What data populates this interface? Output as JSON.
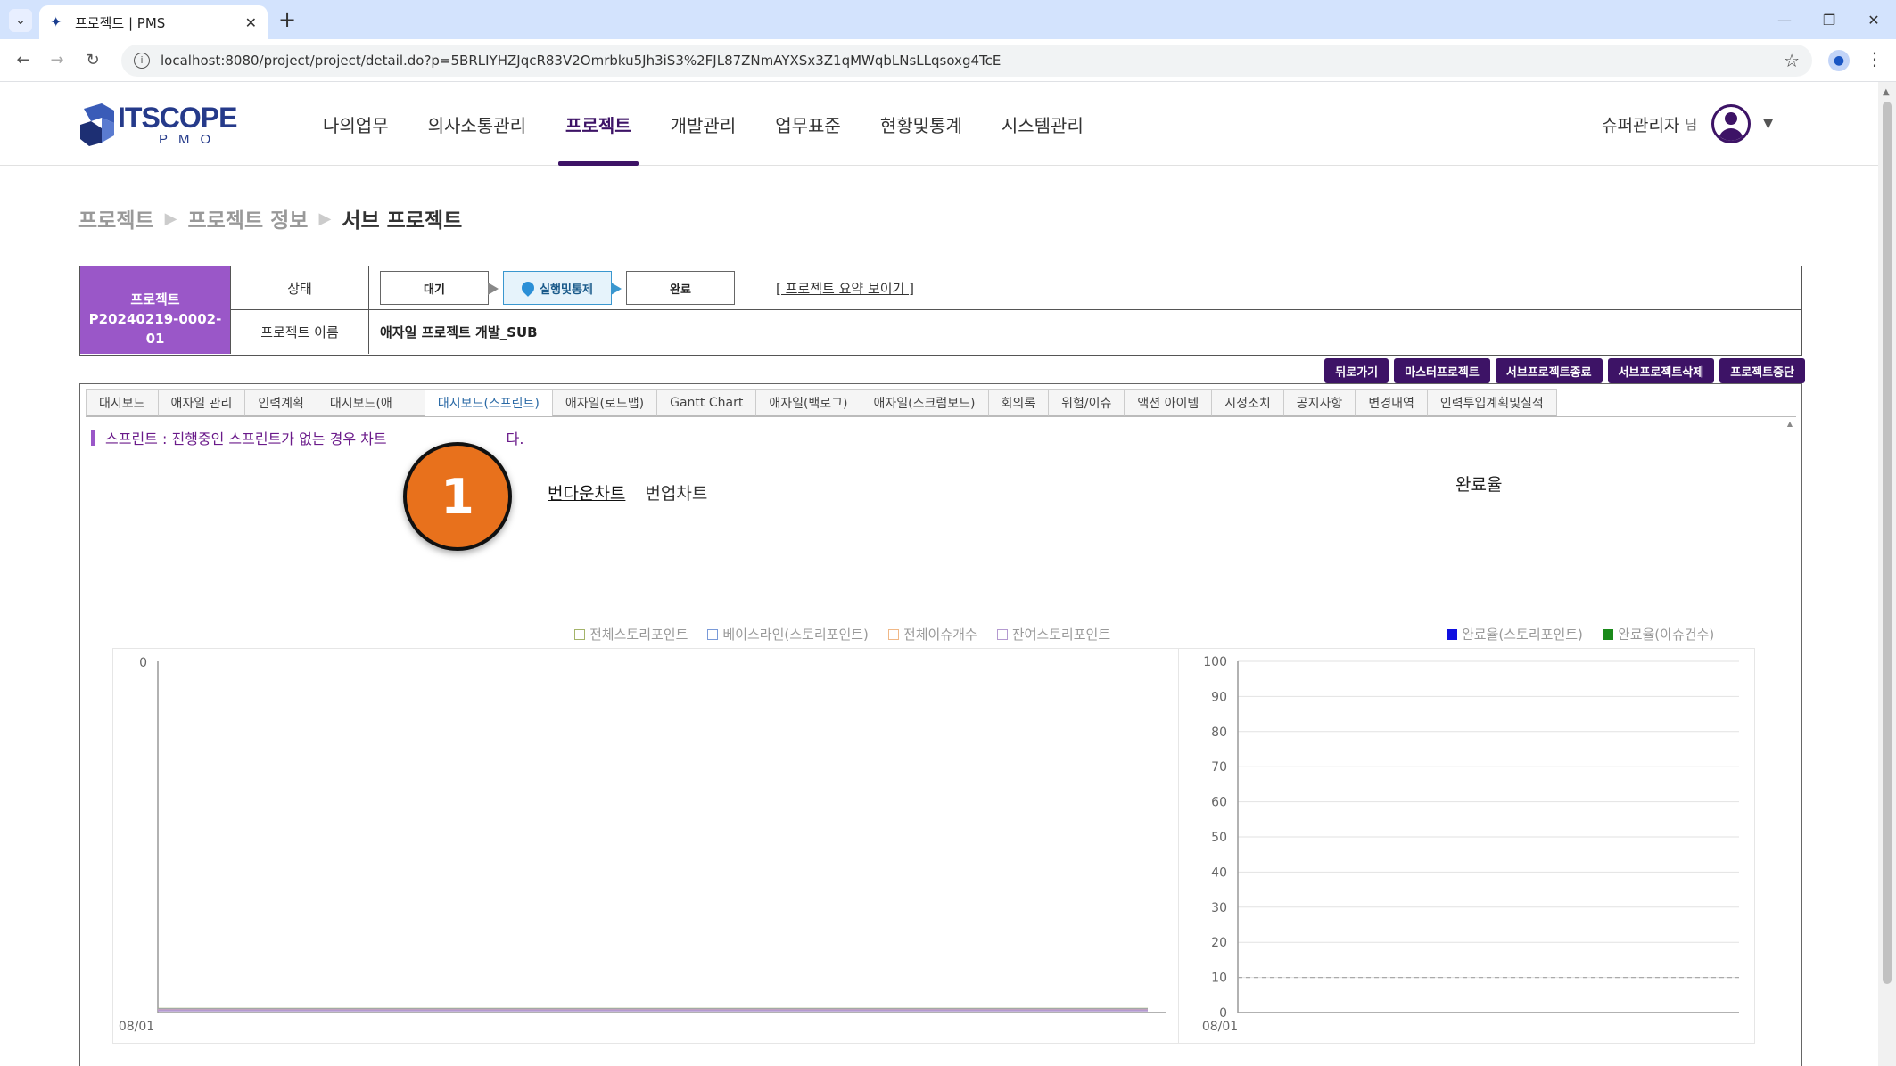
{
  "browser": {
    "tab_title": "프로젝트 | PMS",
    "url": "localhost:8080/project/project/detail.do?p=5BRLIYHZJqcR83V2Omrbku5Jh3iS3%2FJL87ZNmAYXSx3Z1qMWqbLNsLLqsoxg4TcE"
  },
  "header": {
    "logo_text": "ITSCOPE",
    "logo_sub": "PMO",
    "nav": [
      "나의업무",
      "의사소통관리",
      "프로젝트",
      "개발관리",
      "업무표준",
      "현황및통계",
      "시스템관리"
    ],
    "active_nav": "프로젝트",
    "user_name": "슈퍼관리자",
    "user_suffix": "님"
  },
  "breadcrumb": [
    "프로젝트",
    "프로젝트 정보",
    "서브 프로젝트"
  ],
  "project": {
    "id_label": "프로젝트",
    "id_value": "P20240219-0002-01",
    "status_label": "상태",
    "steps": [
      "대기",
      "실행및통제",
      "완료"
    ],
    "active_step": "실행및통제",
    "summary_link": "[ 프로젝트 요약 보이기 ]",
    "name_label": "프로젝트 이름",
    "name_value": "애자일 프로젝트 개발_SUB"
  },
  "actions": [
    "뒤로가기",
    "마스터프로젝트",
    "서브프로젝트종료",
    "서브프로젝트삭제",
    "프로젝트중단"
  ],
  "tabs": [
    "대시보드",
    "애자일 관리",
    "인력계획",
    "대시보드(애",
    "대시보드(스프린트)",
    "애자일(로드맵)",
    "Gantt Chart",
    "애자일(백로그)",
    "애자일(스크럼보드)",
    "회의록",
    "위험/이슈",
    "액션 아이템",
    "시정조치",
    "공지사항",
    "변경내역",
    "인력투입계획및실적"
  ],
  "active_tab": "대시보드(스프린트)",
  "notice_visible_a": "스프린트 : 진행중인 스프린트가 없는 경우 차트",
  "notice_visible_b": "다.",
  "chart_switch": [
    "번다운차트",
    "번업차트"
  ],
  "active_chart_switch": "번다운차트",
  "rate_title": "완료율",
  "overlay_badge": "1",
  "colors": {
    "brand_purple": "#3d1366",
    "id_purple": "#9a57c8",
    "badge_orange": "#e8711c"
  },
  "chart_data": [
    {
      "type": "line",
      "title": "번다운차트",
      "series": [
        {
          "name": "전체스토리포인트",
          "values": [
            0
          ],
          "color": "#a4b46a"
        },
        {
          "name": "베이스라인(스토리포인트)",
          "values": [
            0
          ],
          "color": "#7a9ad8"
        },
        {
          "name": "전체이슈개수",
          "values": [
            0
          ],
          "color": "#f0b887"
        },
        {
          "name": "잔여스토리포인트",
          "values": [
            0
          ],
          "color": "#b49ad0"
        }
      ],
      "x": [
        "08/01"
      ],
      "yticks": [
        "0"
      ],
      "ylim": [
        0,
        0
      ],
      "legend": "top-right"
    },
    {
      "type": "line",
      "title": "완료율",
      "series": [
        {
          "name": "완료율(스토리포인트)",
          "values": [],
          "color": "#1010e0"
        },
        {
          "name": "완료율(이슈건수)",
          "values": [],
          "color": "#1a8a1a"
        }
      ],
      "x": [
        "08/01"
      ],
      "yticks": [
        "0",
        "10",
        "20",
        "30",
        "40",
        "50",
        "60",
        "70",
        "80",
        "90",
        "100"
      ],
      "ylim": [
        0,
        100
      ],
      "reference_line": 10,
      "grid": true,
      "legend": "top-right"
    }
  ]
}
